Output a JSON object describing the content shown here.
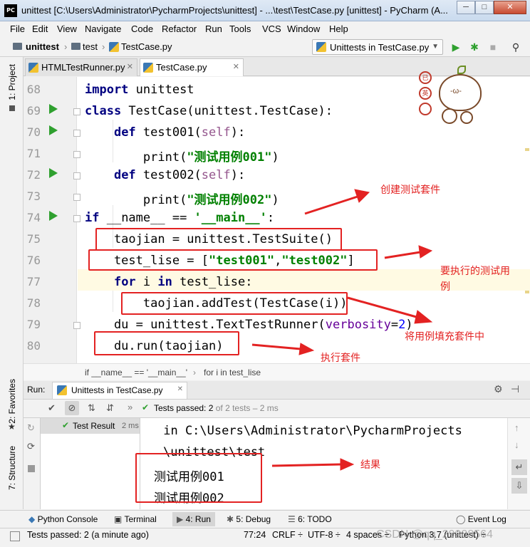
{
  "window": {
    "title": "unittest [C:\\Users\\Administrator\\PycharmProjects\\unittest] - ...\\test\\TestCase.py [unittest] - PyCharm (A...",
    "logo": "PC",
    "min": "─",
    "max": "□",
    "close": "✕"
  },
  "menu": [
    "File",
    "Edit",
    "View",
    "Navigate",
    "Code",
    "Refactor",
    "Run",
    "Tools",
    "VCS",
    "Window",
    "Help"
  ],
  "nav": {
    "crumbs": [
      "unittest",
      "test",
      "TestCase.py"
    ],
    "run_config": "Unittests in TestCase.py"
  },
  "side": {
    "project": "1: Project",
    "favorites": "2: Favorites",
    "structure": "7: Structure"
  },
  "tabs": [
    {
      "label": "HTMLTestRunner.py"
    },
    {
      "label": "TestCase.py"
    }
  ],
  "code": {
    "line_numbers": [
      "68",
      "69",
      "70",
      "71",
      "72",
      "73",
      "74",
      "75",
      "76",
      "77",
      "78",
      "79",
      "80"
    ],
    "l68": {
      "kw": "import",
      "rest": " unittest"
    },
    "l69": {
      "kw": "class",
      "rest": " TestCase(unittest.TestCase):"
    },
    "l70": {
      "indent": "    ",
      "kw": "def",
      "name": " test001(",
      "self": "self",
      "end": "):"
    },
    "l71": {
      "indent": "        ",
      "fn": "print(",
      "str": "\"测试用例001\"",
      "end": ")"
    },
    "l72": {
      "indent": "    ",
      "kw": "def",
      "name": " test002(",
      "self": "self",
      "end": "):"
    },
    "l73": {
      "indent": "        ",
      "fn": "print(",
      "str": "\"测试用例002\"",
      "end": ")"
    },
    "l74": {
      "kw": "if",
      "mid": " __name__ == ",
      "str": "'__main__'",
      "end": ":"
    },
    "l75": {
      "text": "    taojian = unittest.TestSuite()"
    },
    "l76": {
      "pre": "    test_lise = [",
      "s1": "\"test001\"",
      "comma": ",",
      "s2": "\"test002\"",
      "end": "]"
    },
    "l77": {
      "indent": "    ",
      "kw1": "for",
      "mid": " i ",
      "kw2": "in",
      "end": " test_lise:"
    },
    "l78": {
      "text": "        taojian.addTest(TestCase(i))"
    },
    "l79": {
      "pre": "    du = unittest.TextTestRunner(",
      "kwarg": "verbosity",
      "eq": "=",
      "num": "2",
      "end": ")"
    },
    "l80": {
      "text": "    du.run(taojian)"
    }
  },
  "code_breadcrumb": [
    "if __name__ == '__main__'",
    "for i in test_lise"
  ],
  "run": {
    "label": "Run:",
    "tab": "Unittests in TestCase.py",
    "status_bold": "Tests passed: 2",
    "status_rest": " of 2 tests – 2 ms",
    "tree_item": "Test Result",
    "tree_time": "2 ms",
    "console_lines": [
      " in C:\\Users\\Administrator\\PycharmProjects",
      "\\unittest\\test",
      "测试用例001",
      "测试用例002"
    ]
  },
  "tool_tabs": [
    "Python Console",
    "Terminal",
    "4: Run",
    "5: Debug",
    "6: TODO",
    "Event Log"
  ],
  "status": {
    "message": "Tests passed: 2 (a minute ago)",
    "position": "77:24",
    "line_sep": "CRLF ÷",
    "encoding": "UTF-8 ÷",
    "indent": "4 spaces ÷",
    "interpreter": "Python 3.7 (unittest) ÷",
    "watermark": "CSDN @qq_29908564"
  },
  "annotations": {
    "create_suite": "创建测试套件",
    "cases_line1": "要执行的测试用",
    "cases_line2": "例",
    "fill_suite": "将用例填充套件中",
    "execute": "执行套件",
    "result": "结果"
  },
  "sticker": {
    "badge1": "已",
    "badge2": "英",
    "face": "-ω-"
  },
  "colors": {
    "annotation_red": "#e32222",
    "keyword": "#000080",
    "string": "#008000",
    "run_green": "#2fa02f"
  }
}
